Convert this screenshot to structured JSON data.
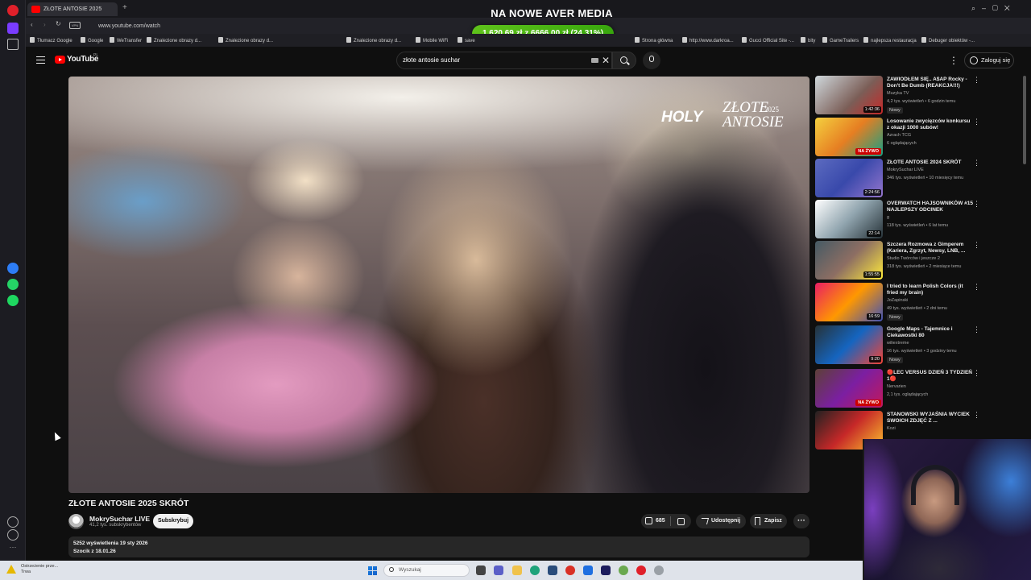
{
  "stream_overlay": {
    "headline": "NA NOWE AVER MEDIA",
    "donation_text": "1 620,69 zł z 6666,00 zł (24.31%)",
    "donation_progress_percent": 24.31
  },
  "browser": {
    "tab_title": "ZŁOTE ANTOSIE 2025",
    "url": "www.youtube.com/watch",
    "bookmarks": [
      "Tłumacz Google",
      "Google",
      "WeTransfer",
      "Znalezione obrazy d...",
      "Znalezione obrazy d...",
      "Znalezione obrazy d...",
      "Mobile WiFi",
      "save",
      "Strona główna",
      "http://www.darkroa...",
      "Gucci Official Site -...",
      "bity",
      "GameTrailers",
      "najlepsza restauracja",
      "Debuger obiektów -..."
    ]
  },
  "youtube": {
    "logo_text": "YouTube",
    "country_code": "PL",
    "search_query": "złote antosie suchar",
    "signin_label": "Zaloguj się"
  },
  "video": {
    "overlay_brand": "HOLY",
    "overlay_title": "ZŁOTE ANTOSIE",
    "overlay_year": "2025",
    "title": "ZŁOTE ANTOSIE 2025 SKRÓT",
    "channel": "MokrySuchar LIVE",
    "subscribers": "41,2 tys. subskrybentów",
    "subscribe_label": "Subskrybuj",
    "likes": "685",
    "share_label": "Udostępnij",
    "save_label": "Zapisz",
    "more_label": "···",
    "views_date": "5252 wyświetlenia  19 sty 2026",
    "desc_line": "Szocik z 18.01.26"
  },
  "recommendations": [
    {
      "title": "ZAWIODŁEM SIĘ.. A$AP Rocky - Don't Be Dumb (REAKCJA!!!)",
      "channel": "Muzyka TV",
      "meta": "4,2 tys. wyświetleń • 6 godzin temu",
      "badge": "Nowy",
      "duration": "1:42:36",
      "live": ""
    },
    {
      "title": "Losowanie zwycięzców konkursu z okazji 1000 subów!",
      "channel": "Azrach TCG",
      "meta": "6 oglądających",
      "badge": "",
      "duration": "",
      "live": "NA ŻYWO"
    },
    {
      "title": "ZŁOTE ANTOSIE 2024 SKRÓT",
      "channel": "MokrySuchar LIVE",
      "meta": "346 tys. wyświetleń • 10 miesięcy temu",
      "badge": "",
      "duration": "2:24:56",
      "live": ""
    },
    {
      "title": "OVERWATCH HAJSOWNIKÓW #15 NAJLEPSZY ODCINEK",
      "channel": "g",
      "meta": "118 tys. wyświetleń • 6 lat temu",
      "badge": "",
      "duration": "22:14",
      "live": ""
    },
    {
      "title": "Szczera Rozmowa z Gimperem (Kariera, Zgrzyt, Newsy, LNB, ...",
      "channel": "Studio Twórców i jeszcze 2",
      "meta": "318 tys. wyświetleń • 2 miesiące temu",
      "badge": "",
      "duration": "1:55:55",
      "live": ""
    },
    {
      "title": "I tried to learn Polish Colors (it fried my brain)",
      "channel": "JoZapinski",
      "meta": "49 tys. wyświetleń • 2 dni temu",
      "badge": "Nowy",
      "duration": "16:59",
      "live": ""
    },
    {
      "title": "Google Maps - Tajemnice i Ciekawostki 80",
      "channel": "wiliextreme",
      "meta": "16 tys. wyświetleń • 3 godziny temu",
      "badge": "Nowy",
      "duration": "9:20",
      "live": ""
    },
    {
      "title": "🔴LEC VERSUS DZIEŃ 3 TYDZIEŃ 1🔴",
      "channel": "Nervarien",
      "meta": "2,1 tys. oglądających",
      "badge": "",
      "duration": "",
      "live": "NA ŻYWO"
    },
    {
      "title": "STANOWSKI WYJAŚNIA WYCIEK SWOICH ZDJĘĆ Z ...",
      "channel": "Kozi",
      "meta": "",
      "badge": "",
      "duration": "",
      "live": ""
    }
  ],
  "taskbar": {
    "warning_title": "Ostrzeżenie prze...",
    "warning_sub": "Trwa",
    "search_placeholder": "Wyszukaj"
  },
  "colors": {
    "yt_red": "#ff0000",
    "donation_green": "#4fb813",
    "background": "#0f0f0f"
  }
}
